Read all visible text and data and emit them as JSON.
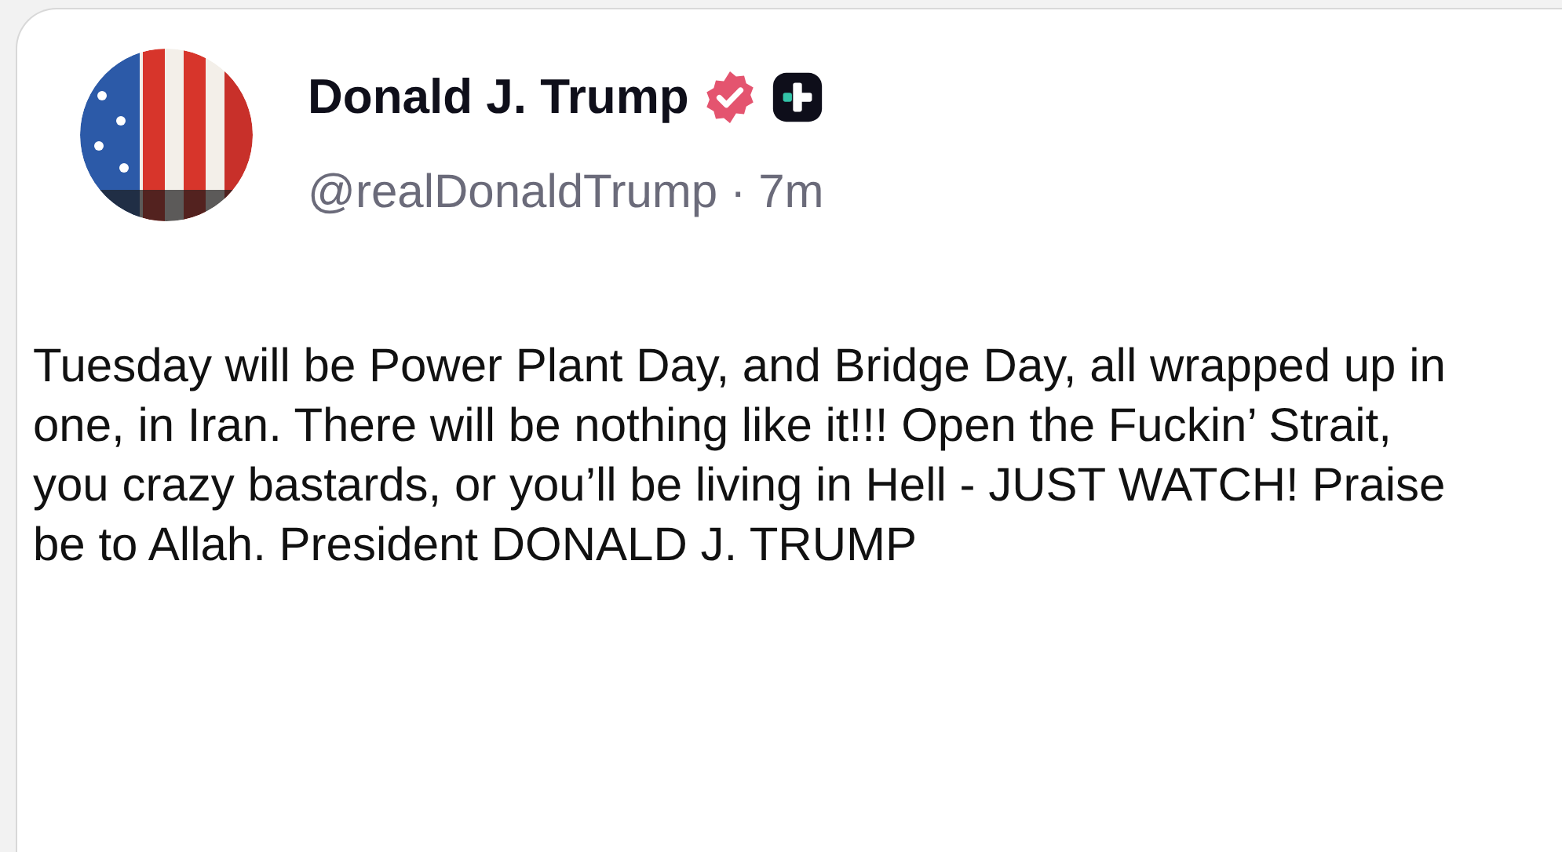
{
  "post": {
    "author": "Donald J. Trump",
    "verified": true,
    "plus_badge": true,
    "handle": "@realDonaldTrump",
    "separator": "·",
    "time": "7m",
    "text": "Tuesday will be Power Plant Day, and Bridge Day, all wrapped up in one, in Iran. There will be nothing like it!!! Open the Fuckin’ Strait, you crazy bastards, or you’ll be living in Hell - JUST WATCH! Praise be to Allah. President DONALD J. TRUMP"
  }
}
